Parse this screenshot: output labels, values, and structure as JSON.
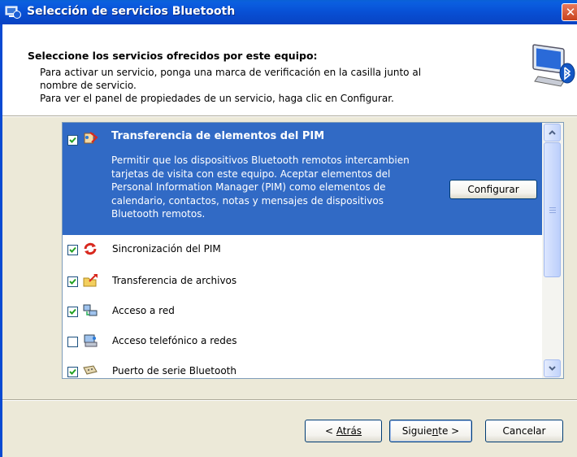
{
  "window": {
    "title": "Selección de servicios Bluetooth",
    "close_glyph": "✕"
  },
  "header": {
    "heading": "Seleccione los servicios ofrecidos por este equipo:",
    "line1": "Para activar un servicio, ponga una marca de verificación en la casilla junto al",
    "line2": "nombre de servicio.",
    "line3": "Para ver el panel de propiedades de un servicio, haga clic en Configurar.",
    "icon": "computer-bluetooth-icon"
  },
  "services": {
    "selected": {
      "label": "Transferencia de elementos del PIM",
      "checked": true,
      "icon": "pim-transfer-icon",
      "description": "Permitir que los dispositivos Bluetooth remotos intercambien\ntarjetas de visita con este equipo. Aceptar elementos del\nPersonal Information Manager (PIM) como elementos de\ncalendario, contactos, notas y mensajes de dispositivos\nBluetooth remotos.",
      "configure_label": "Configurar"
    },
    "items": [
      {
        "label": "Sincronización del PIM",
        "checked": true,
        "icon": "pim-sync-icon"
      },
      {
        "label": "Transferencia de archivos",
        "checked": true,
        "icon": "file-transfer-icon"
      },
      {
        "label": "Acceso a red",
        "checked": true,
        "icon": "network-access-icon"
      },
      {
        "label": "Acceso telefónico a redes",
        "checked": false,
        "icon": "dialup-icon"
      },
      {
        "label": "Puerto de serie Bluetooth",
        "checked": true,
        "icon": "serial-port-icon"
      }
    ]
  },
  "buttons": {
    "back_label": "Atrás",
    "back_prefix": "< ",
    "next_label_a": "Siguie",
    "next_label_u": "n",
    "next_label_b": "te >",
    "cancel_label": "Cancelar"
  },
  "colors": {
    "titlebar": "#0851d6",
    "selection": "#316ac5",
    "dialog_bg": "#ece9d8"
  }
}
